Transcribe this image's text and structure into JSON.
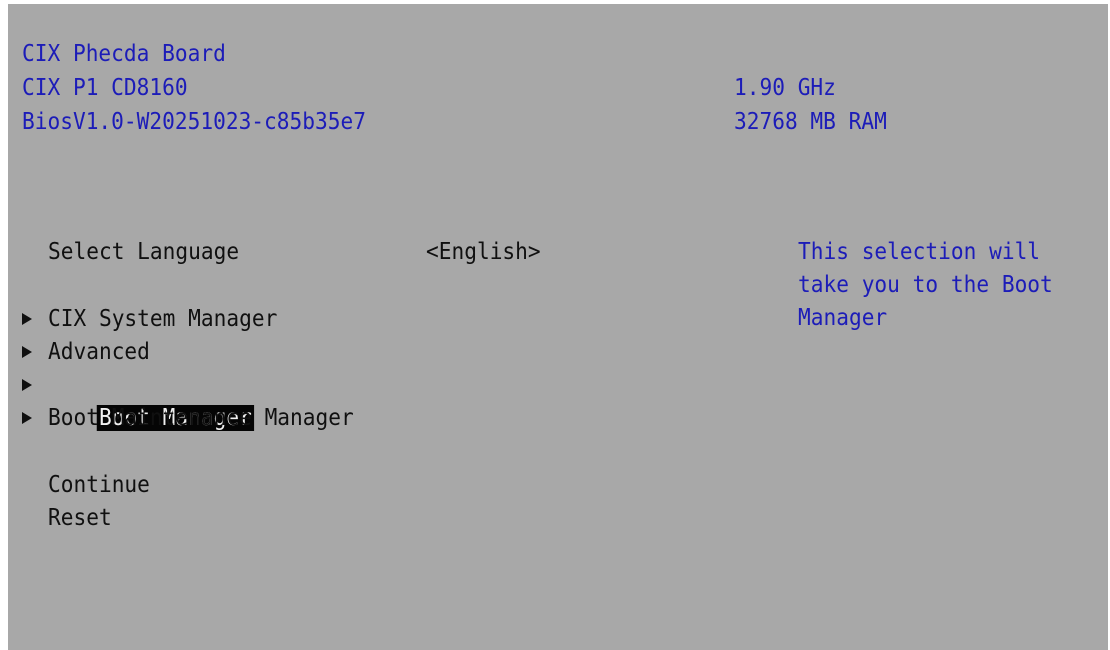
{
  "header": {
    "board_name": "CIX Phecda Board",
    "cpu_model": "CIX P1 CD8160",
    "bios_version": "BiosV1.0-W20251023-c85b35e7",
    "cpu_speed": "1.90 GHz",
    "memory": "32768 MB RAM"
  },
  "language": {
    "label": "Select Language",
    "value": "<English>"
  },
  "menu": {
    "items": [
      {
        "label": "CIX System Manager"
      },
      {
        "label": "Advanced"
      },
      {
        "label": "Boot Manager",
        "selected": true
      },
      {
        "label": "Boot Maintenance Manager"
      }
    ]
  },
  "actions": {
    "continue_label": "Continue",
    "reset_label": "Reset"
  },
  "help": {
    "lines": [
      "This selection will",
      "take you to the Boot",
      "Manager"
    ]
  },
  "colors": {
    "background": "#a8a8a8",
    "info_text": "#1c1cb8",
    "menu_text": "#101010",
    "highlight_bg": "#050505",
    "highlight_text": "#f0f0f0"
  }
}
